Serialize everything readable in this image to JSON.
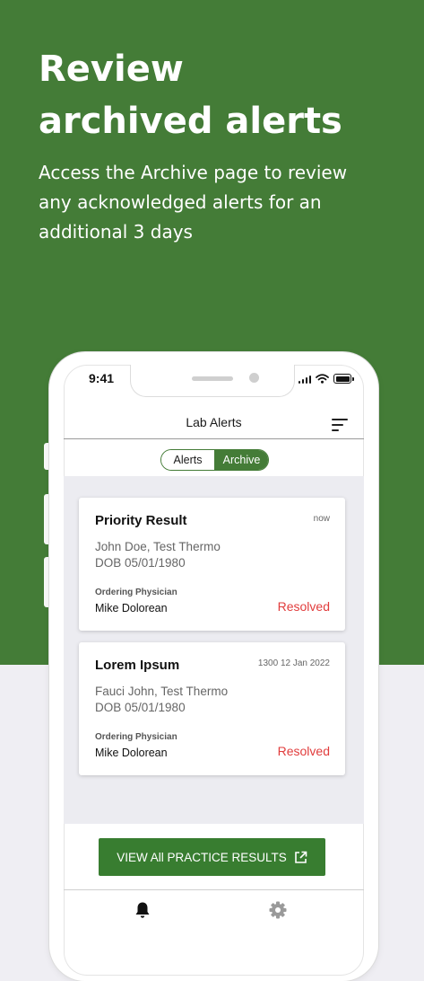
{
  "hero": {
    "title_line1": "Review",
    "title_line2": "archived alerts",
    "subtitle_line1": "Access the Archive page to review",
    "subtitle_line2": "any acknowledged alerts for an",
    "subtitle_line3": "additional 3 days"
  },
  "status_bar": {
    "time": "9:41"
  },
  "header": {
    "title": "Lab Alerts"
  },
  "segmented": {
    "alerts_label": "Alerts",
    "archive_label": "Archive",
    "selected": "Archive"
  },
  "cards": [
    {
      "title": "Priority Result",
      "time": "now",
      "patient": "John Doe, Test Thermo",
      "dob": "DOB 05/01/1980",
      "physician_label": "Ordering Physician",
      "physician": "Mike Dolorean",
      "status": "Resolved"
    },
    {
      "title": "Lorem Ipsum",
      "time": "1300 12 Jan 2022",
      "patient": "Fauci John, Test Thermo",
      "dob": "DOB 05/01/1980",
      "physician_label": "Ordering Physician",
      "physician": "Mike Dolorean",
      "status": "Resolved"
    }
  ],
  "cta": {
    "label": "VIEW All PRACTICE RESULTS",
    "icon": "external-link-icon"
  },
  "tabbar": {
    "icons": [
      "bell-icon",
      "gear-icon"
    ]
  },
  "colors": {
    "brand_green": "#447c37",
    "button_green": "#387d30",
    "resolved_red": "#e13c3c",
    "list_background": "#ececf1"
  }
}
